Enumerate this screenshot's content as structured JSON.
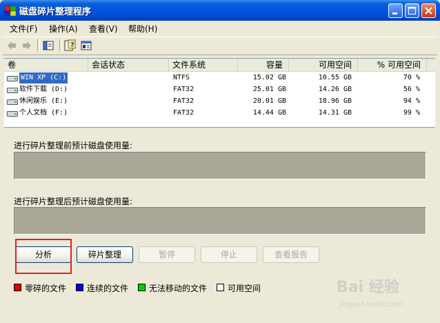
{
  "window": {
    "title": "磁盘碎片整理程序"
  },
  "menu": {
    "items": [
      {
        "label": "文件(F)"
      },
      {
        "label": "操作(A)"
      },
      {
        "label": "查看(V)"
      },
      {
        "label": "帮助(H)"
      }
    ]
  },
  "toolbar": {
    "icons": [
      "back-arrow",
      "forward-arrow",
      "console-tree",
      "help",
      "properties"
    ]
  },
  "volumes": {
    "columns": [
      "卷",
      "会话状态",
      "文件系统",
      "容量",
      "可用空间",
      "% 可用空间"
    ],
    "rows": [
      {
        "name": "WIN XP (C:)",
        "status": "",
        "fs": "NTFS",
        "capacity": "15.02 GB",
        "free": "10.55 GB",
        "pct": "70 %"
      },
      {
        "name": "软件下载 (D:)",
        "status": "",
        "fs": "FAT32",
        "capacity": "25.01 GB",
        "free": "14.26 GB",
        "pct": "56 %"
      },
      {
        "name": "休闲娱乐 (E:)",
        "status": "",
        "fs": "FAT32",
        "capacity": "20.01 GB",
        "free": "18.96 GB",
        "pct": "94 %"
      },
      {
        "name": "个人文档 (F:)",
        "status": "",
        "fs": "FAT32",
        "capacity": "14.44 GB",
        "free": "14.31 GB",
        "pct": "99 %"
      }
    ],
    "selected_index": 0
  },
  "panes": {
    "before_label": "进行碎片整理前预计磁盘使用量:",
    "after_label": "进行碎片整理后预计磁盘使用量:"
  },
  "buttons": {
    "analyze": "分析",
    "defragment": "碎片整理",
    "pause": "暂停",
    "stop": "停止",
    "view_report": "查看报告"
  },
  "legend": {
    "items": [
      {
        "label": "零碎的文件",
        "color": "#e00000"
      },
      {
        "label": "连续的文件",
        "color": "#0000e0"
      },
      {
        "label": "无法移动的文件",
        "color": "#00d000"
      },
      {
        "label": "可用空间",
        "color": "#ffffff"
      }
    ]
  },
  "watermark": {
    "text": "Bai 经验",
    "url": "jingyan.baidu.com"
  },
  "colors": {
    "titlebar": "#0054e3",
    "selection": "#316ac5",
    "highlight_box": "#e02020"
  }
}
